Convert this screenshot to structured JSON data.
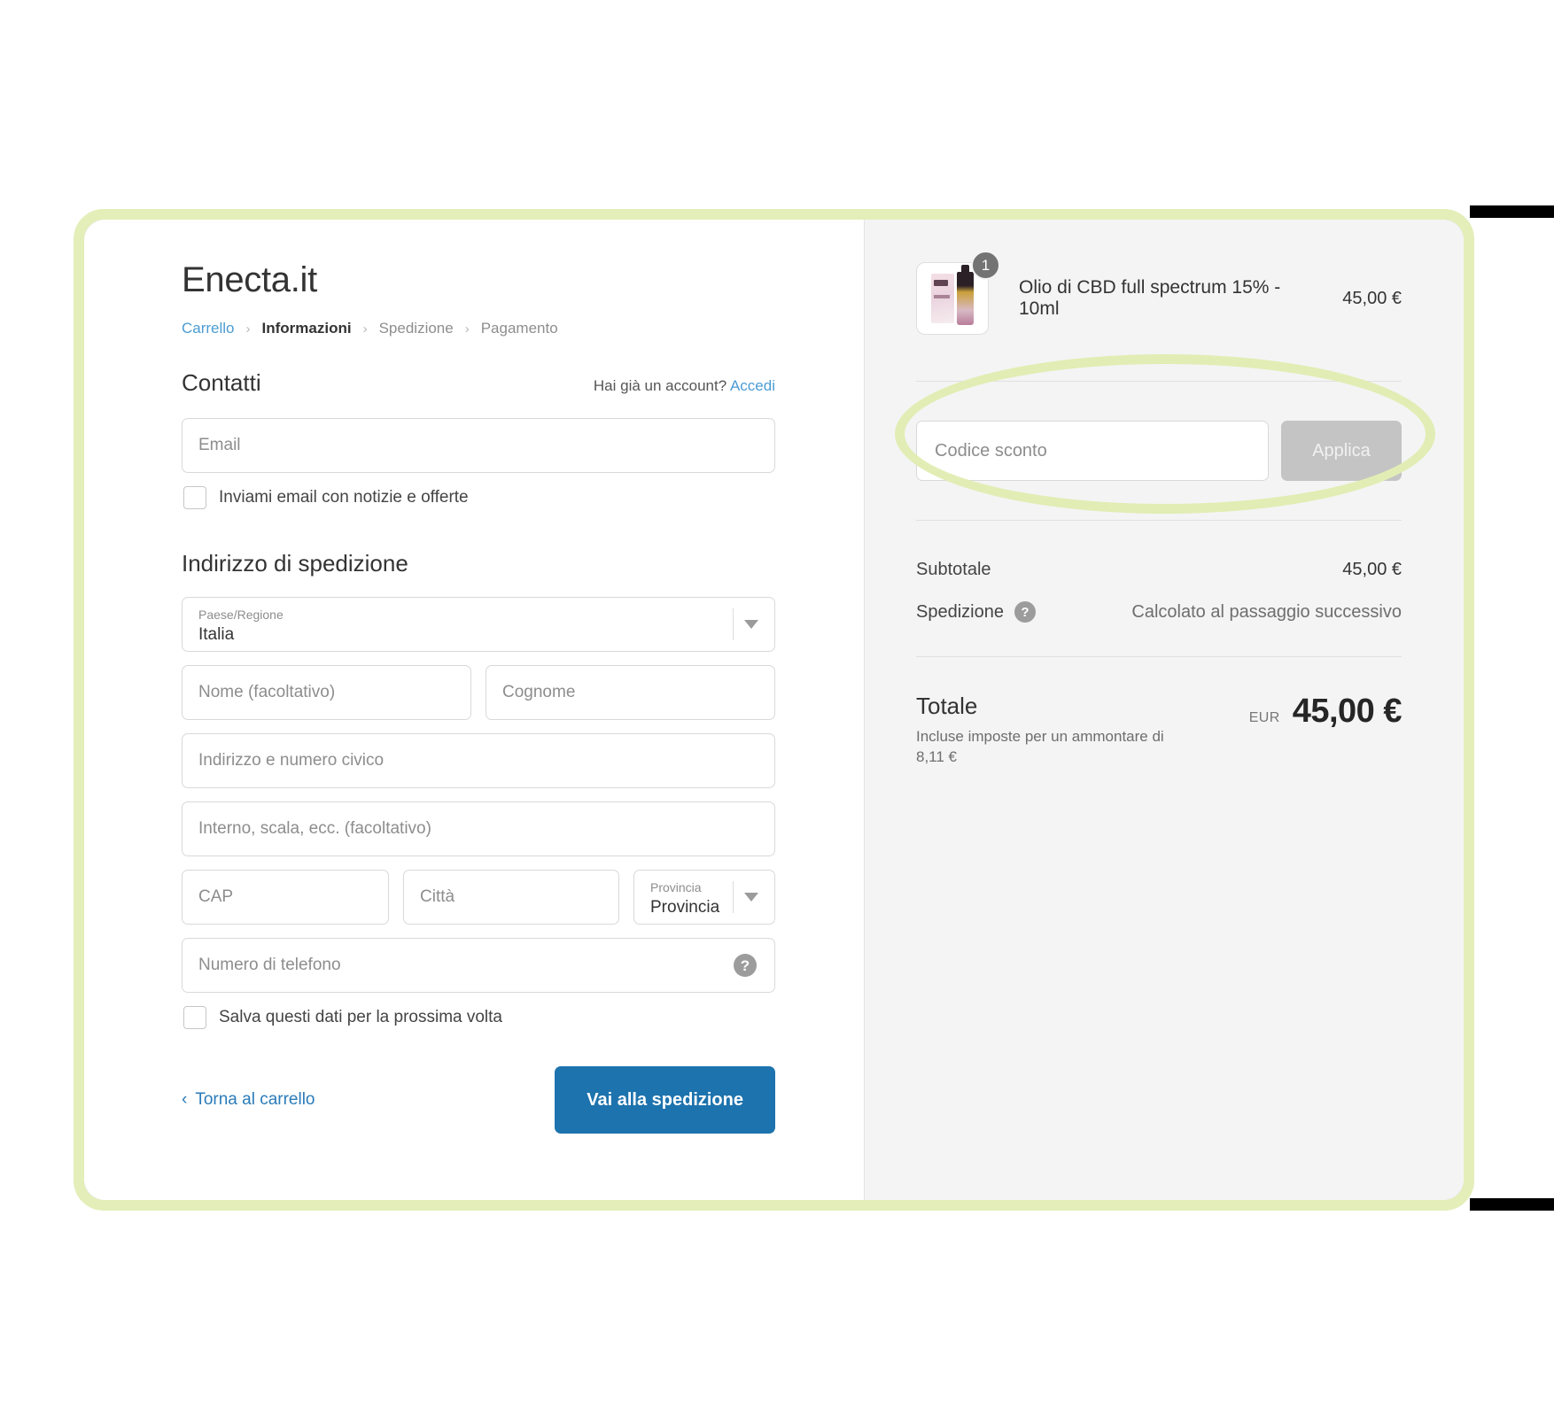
{
  "store": {
    "title": "Enecta.it"
  },
  "breadcrumb": [
    {
      "label": "Carrello",
      "state": "link"
    },
    {
      "label": "Informazioni",
      "state": "current"
    },
    {
      "label": "Spedizione",
      "state": "muted"
    },
    {
      "label": "Pagamento",
      "state": "muted"
    }
  ],
  "breadcrumb_separator": "›",
  "contacts": {
    "title": "Contatti",
    "account_prompt": "Hai già un account?",
    "login_link": "Accedi",
    "email_placeholder": "Email",
    "newsletter_label": "Inviami email con notizie e offerte"
  },
  "shipping": {
    "title": "Indirizzo di spedizione",
    "country_label": "Paese/Regione",
    "country_value": "Italia",
    "first_name_placeholder": "Nome (facoltativo)",
    "last_name_placeholder": "Cognome",
    "address_placeholder": "Indirizzo e numero civico",
    "address2_placeholder": "Interno, scala, ecc. (facoltativo)",
    "zip_placeholder": "CAP",
    "city_placeholder": "Città",
    "province_label": "Provincia",
    "province_value": "Provincia",
    "phone_placeholder": "Numero di telefono",
    "phone_help_glyph": "?",
    "save_label": "Salva questi dati per la prossima volta"
  },
  "form_footer": {
    "back_chevron": "‹",
    "back_label": "Torna al carrello",
    "submit_label": "Vai alla spedizione"
  },
  "order_summary": {
    "item": {
      "name": "Olio di CBD full spectrum 15% - 10ml",
      "quantity": "1",
      "price": "45,00 €"
    },
    "discount": {
      "placeholder": "Codice sconto",
      "apply_label": "Applica"
    },
    "subtotal_label": "Subtotale",
    "subtotal_value": "45,00 €",
    "shipping_label": "Spedizione",
    "shipping_help_glyph": "?",
    "shipping_value": "Calcolato al passaggio successivo",
    "total_label": "Totale",
    "total_note": "Incluse imposte per un ammontare di 8,11 €",
    "currency_code": "EUR",
    "total_value": "45,00 €"
  },
  "colors": {
    "accent_blue": "#1d73ad",
    "link_blue": "#4b9cd3",
    "highlight_green": "#e3eeb9",
    "summary_bg": "#f4f4f4"
  }
}
